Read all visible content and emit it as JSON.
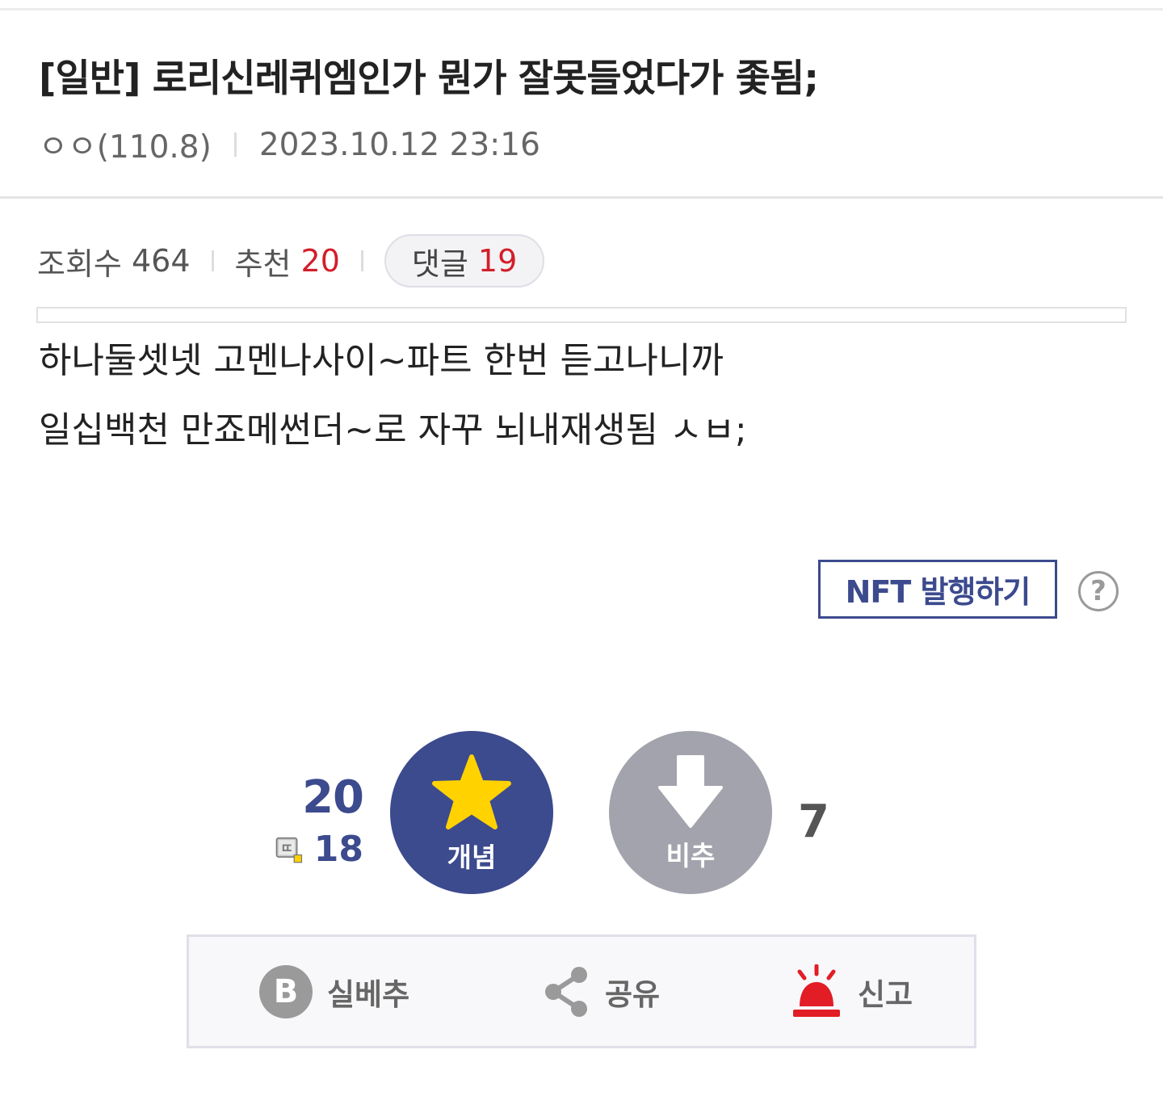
{
  "post": {
    "title": "[일반] 로리신레퀴엠인가 뭔가 잘못들었다가 좇됨;",
    "author": "ㅇㅇ(110.8)",
    "datetime": "2023.10.12 23:16"
  },
  "stats": {
    "views_label": "조회수",
    "views": "464",
    "recommend_label": "추천",
    "recommend": "20",
    "comments_label": "댓글",
    "comments": "19"
  },
  "body": {
    "lines": [
      "하나둘셋넷 고멘나사이~파트 한번 듣고나니까",
      "일십백천 만죠메썬더~로 자꾸 뇌내재생됨 ㅅㅂ;"
    ]
  },
  "nft": {
    "button_label": "NFT 발행하기",
    "help_glyph": "?"
  },
  "vote": {
    "up_count": "20",
    "fixed_count": "18",
    "up_label": "개념",
    "down_label": "비추",
    "down_count": "7",
    "up_color": "#3c4a8e",
    "down_color": "#a3a3ad",
    "star_color": "#ffd200"
  },
  "actions": {
    "realbest_badge": "B",
    "realbest_label": "실베추",
    "share_label": "공유",
    "report_label": "신고",
    "report_color": "#e21d25"
  },
  "icons": [
    "star-icon",
    "down-arrow-icon",
    "fixed-user-icon",
    "share-icon",
    "siren-icon",
    "question-icon"
  ]
}
